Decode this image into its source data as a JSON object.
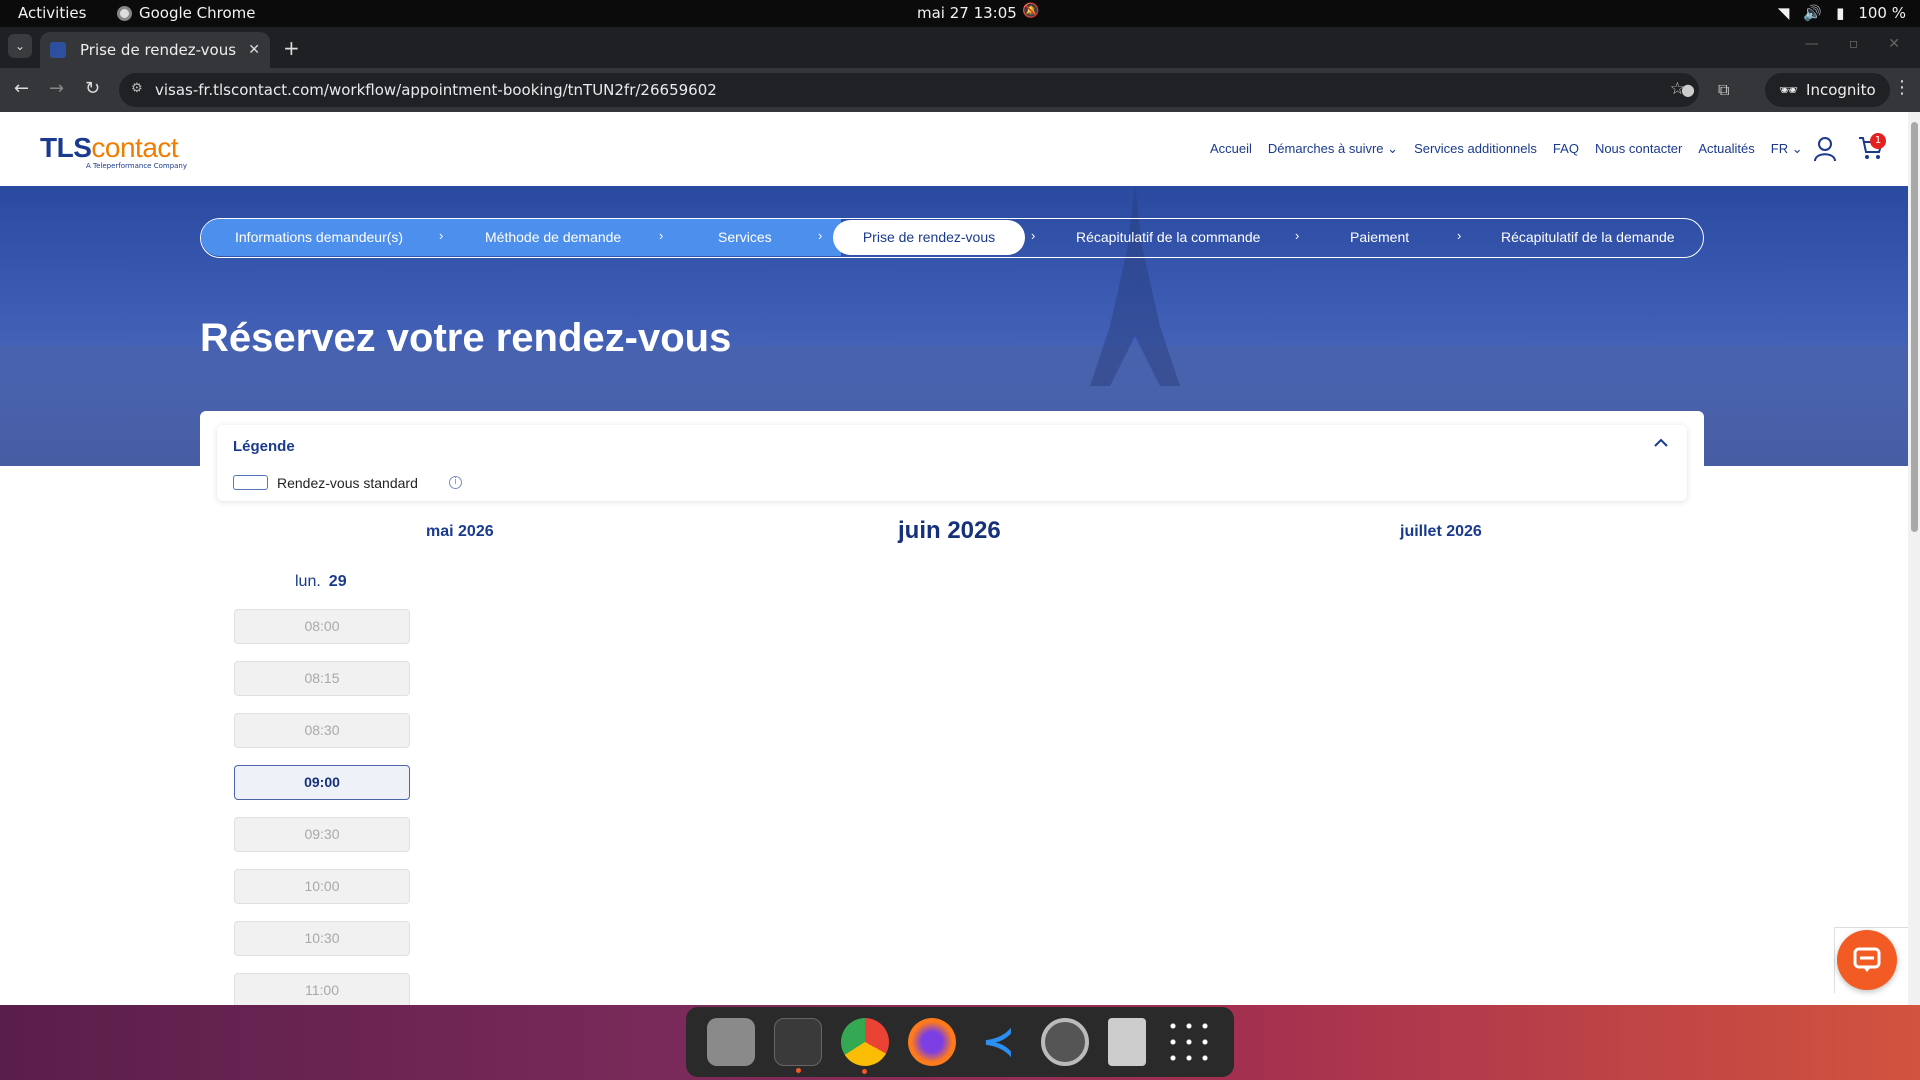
{
  "system": {
    "activities": "Activities",
    "app_name": "Google Chrome",
    "clock": "mai 27  13:05",
    "battery": "100 %"
  },
  "browser": {
    "tab_title": "Prise de rendez-vous | TL",
    "url": "visas-fr.tlscontact.com/workflow/appointment-booking/tnTUN2fr/26659602",
    "incognito_label": "Incognito"
  },
  "site": {
    "logo_tls": "TLS",
    "logo_contact": "contact",
    "logo_sub": "A Teleperformance Company",
    "nav": [
      "Accueil",
      "Démarches à suivre",
      "Services additionnels",
      "FAQ",
      "Nous contacter",
      "Actualités",
      "FR"
    ],
    "cart_count": "1"
  },
  "steps": [
    "Informations demandeur(s)",
    "Méthode de demande",
    "Services",
    "Prise de rendez-vous",
    "Récapitulatif de la commande",
    "Paiement",
    "Récapitulatif de la demande"
  ],
  "hero_title": "Réservez votre rendez-vous",
  "legend": {
    "title": "Légende",
    "item": "Rendez-vous standard"
  },
  "calendar": {
    "prev_month": "mai 2026",
    "current_month": "juin 2026",
    "next_month": "juillet 2026",
    "day_name": "lun.",
    "day_number": "29",
    "slots": [
      {
        "time": "08:00",
        "available": false
      },
      {
        "time": "08:15",
        "available": false
      },
      {
        "time": "08:30",
        "available": false
      },
      {
        "time": "09:00",
        "available": true
      },
      {
        "time": "09:30",
        "available": false
      },
      {
        "time": "10:00",
        "available": false
      },
      {
        "time": "10:30",
        "available": false
      },
      {
        "time": "11:00",
        "available": false
      }
    ]
  },
  "colors": {
    "brand_blue": "#1a3a8f",
    "brand_orange": "#ef7d00",
    "step_done": "#4d8fec",
    "chat": "#f25c24"
  },
  "dock": [
    "files-icon",
    "terminal-icon",
    "chrome-icon",
    "firefox-icon",
    "vscode-icon",
    "settings-icon",
    "trash-icon",
    "app-grid-icon"
  ]
}
